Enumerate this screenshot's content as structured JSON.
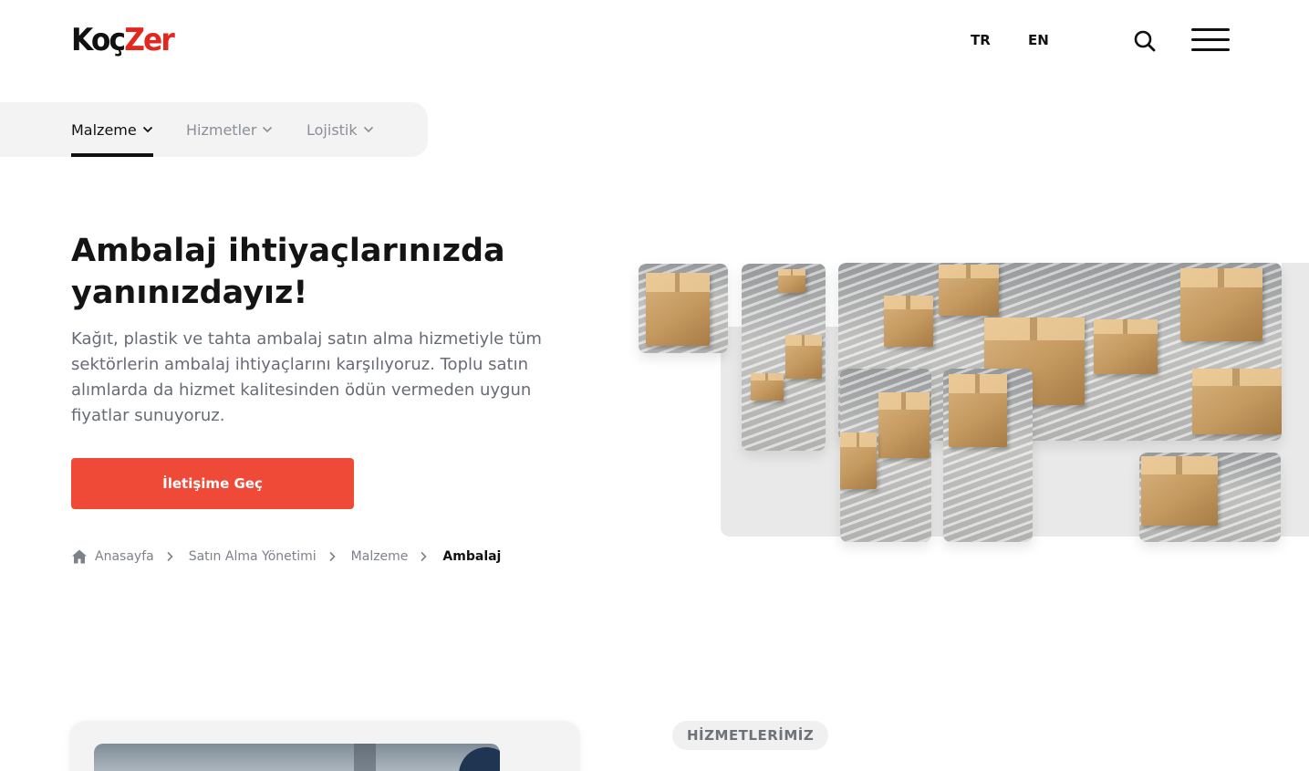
{
  "header": {
    "logo_text_a": "Koç",
    "logo_text_b": "Zer",
    "languages": [
      "TR",
      "EN"
    ]
  },
  "category_nav": {
    "items": [
      {
        "label": "Malzeme",
        "active": true
      },
      {
        "label": "Hizmetler",
        "active": false
      },
      {
        "label": "Lojistik",
        "active": false
      }
    ]
  },
  "hero": {
    "title": "Ambalaj ihtiyaçlarınızda yanınızdayız!",
    "description": "Kağıt, plastik ve tahta ambalaj satın alma hizmetiyle tüm sektörlerin ambalaj ihtiyaçlarını karşılıyoruz. Toplu satın alımlarda da hizmet kalitesinden ödün vermeden uygun fiyatlar sunuyoruz.",
    "cta_label": "İletişime Geç"
  },
  "breadcrumb": {
    "items": [
      "Anasayfa",
      "Satın Alma Yönetimi",
      "Malzeme"
    ],
    "current": "Ambalaj"
  },
  "sections": {
    "services_pill": "HİZMETLERİMİZ"
  },
  "colors": {
    "accent": "#ee4a37",
    "logo_accent": "#e5261f",
    "text_dark": "#141414",
    "text_muted": "#676b73",
    "nav_bg": "#f3f3f3"
  },
  "icons": {
    "search": "search-icon",
    "menu": "hamburger-menu-icon",
    "home": "home-icon",
    "chevron_down": "chevron-down-icon",
    "chevron_right": "chevron-right-icon"
  }
}
